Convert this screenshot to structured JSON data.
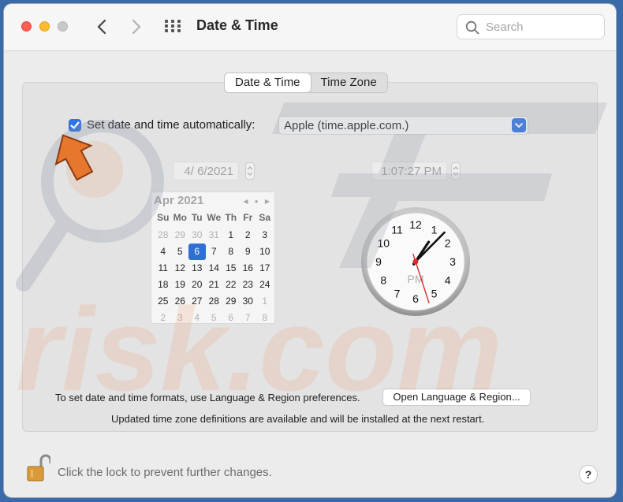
{
  "window": {
    "title": "Date & Time",
    "search_placeholder": "Search"
  },
  "tabs": [
    {
      "label": "Date & Time",
      "active": true
    },
    {
      "label": "Time Zone",
      "active": false
    }
  ],
  "auto": {
    "checked": true,
    "label": "Set date and time automatically:",
    "server": "Apple (time.apple.com.)"
  },
  "date_field": "4/  6/2021",
  "time_field": "1:07:27 PM",
  "calendar": {
    "month": "Apr 2021",
    "nav_symbols": "◀ ● ▶",
    "weekdays": [
      "Su",
      "Mo",
      "Tu",
      "We",
      "Th",
      "Fr",
      "Sa"
    ],
    "weeks": [
      [
        "28",
        "29",
        "30",
        "31",
        "1",
        "2",
        "3"
      ],
      [
        "4",
        "5",
        "6",
        "7",
        "8",
        "9",
        "10"
      ],
      [
        "11",
        "12",
        "13",
        "14",
        "15",
        "16",
        "17"
      ],
      [
        "18",
        "19",
        "20",
        "21",
        "22",
        "23",
        "24"
      ],
      [
        "25",
        "26",
        "27",
        "28",
        "29",
        "30",
        "1"
      ],
      [
        "2",
        "3",
        "4",
        "5",
        "6",
        "7",
        "8"
      ]
    ],
    "selected": "6"
  },
  "clock": {
    "numbers": [
      "12",
      "1",
      "2",
      "3",
      "4",
      "5",
      "6",
      "7",
      "8",
      "9",
      "10",
      "11"
    ],
    "ampm": "PM",
    "time": {
      "hour": 1,
      "minute": 7,
      "second": 27
    }
  },
  "footer": {
    "format_text": "To set date and time formats, use Language & Region preferences.",
    "open_button": "Open Language & Region...",
    "tz_note": "Updated time zone definitions are available and will be installed at the next restart.",
    "lock_text": "Click the lock to prevent further changes.",
    "help": "?"
  },
  "colors": {
    "accent": "#2f73e6",
    "arrow": "#e8772e",
    "watermark": "#e9a47f"
  }
}
